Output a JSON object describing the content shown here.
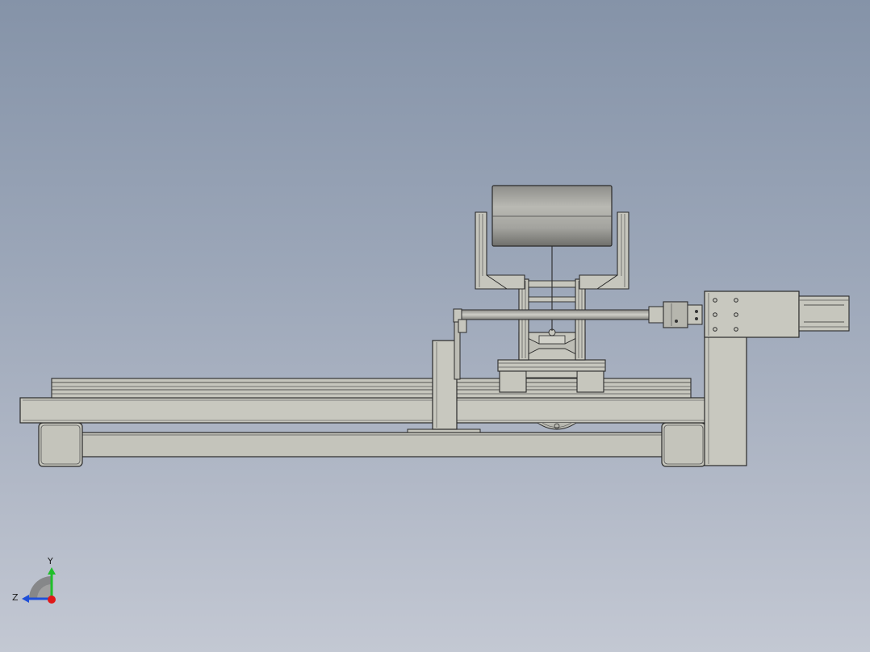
{
  "view": {
    "background_top": "#8593a8",
    "background_bottom": "#c3c8d3",
    "part_fill": "#c4c4bb",
    "part_edge": "#2a2a2a",
    "motor_fill": "#9c9c98"
  },
  "triad": {
    "y_label": "Y",
    "z_label": "Z",
    "y_color": "#1fbf2a",
    "z_color": "#1f4fd8",
    "x_color": "#e01818"
  }
}
